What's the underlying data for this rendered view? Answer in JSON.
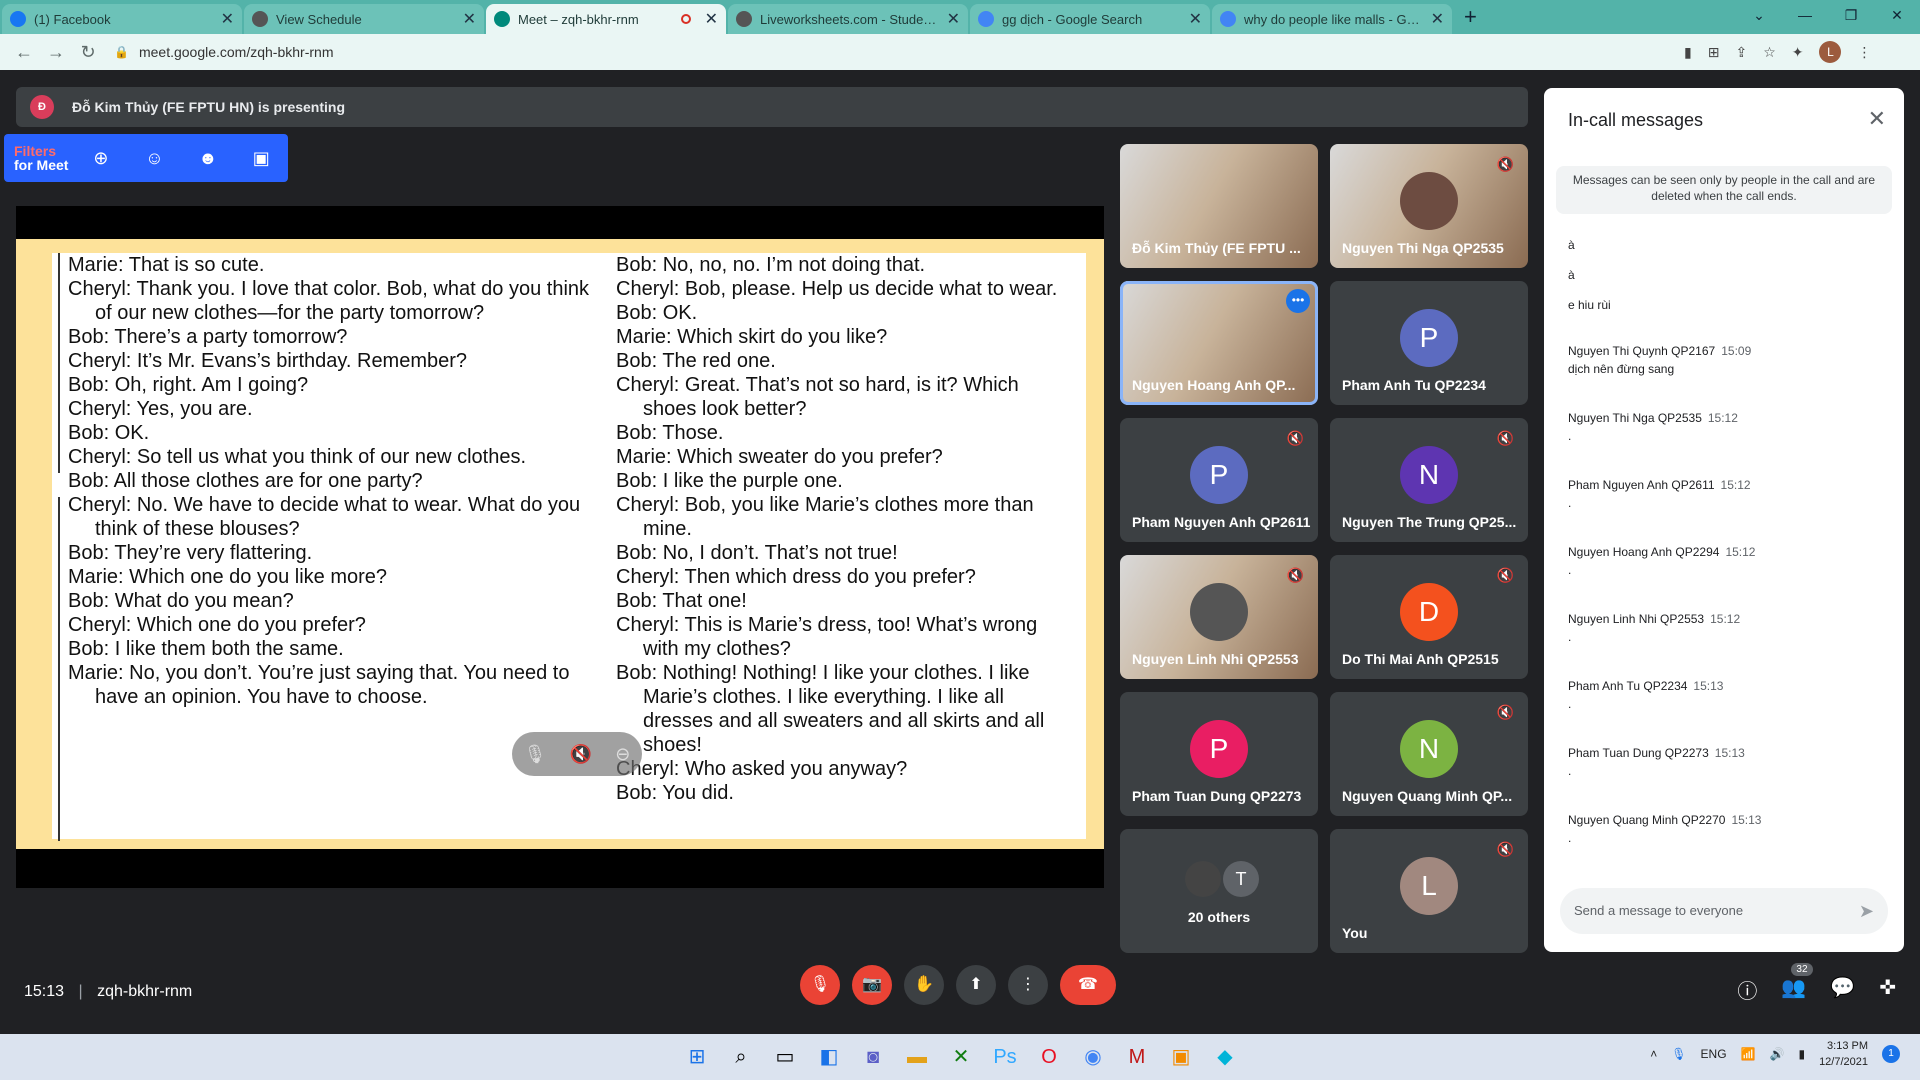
{
  "browser": {
    "tabs": [
      {
        "title": "(1) Facebook",
        "icon": "facebook-icon",
        "color": "#1877f2"
      },
      {
        "title": "View Schedule",
        "icon": "globe-icon",
        "color": "#555"
      },
      {
        "title": "Meet – zqh-bkhr-rnm",
        "icon": "meet-icon",
        "color": "#00897b",
        "active": true
      },
      {
        "title": "Liveworksheets.com - Student w...",
        "icon": "globe-icon",
        "color": "#555"
      },
      {
        "title": "gg dịch - Google Search",
        "icon": "google-icon",
        "color": "#4285f4"
      },
      {
        "title": "why do people like malls - Googl...",
        "icon": "google-icon",
        "color": "#4285f4"
      }
    ],
    "url": "meet.google.com/zqh-bkhr-rnm",
    "profile_initial": "L"
  },
  "presenting": {
    "initial": "Đ",
    "text": "Đỗ Kim Thủy (FE FPTU HN) is presenting"
  },
  "filters": {
    "line1": "Filters",
    "line2": "for Meet"
  },
  "slide": {
    "left": [
      "Marie: That is so cute.",
      "Cheryl: Thank you. I love that color. Bob, what do you think of our new clothes—for the party tomorrow?",
      "Bob: There’s a party tomorrow?",
      "Cheryl: It’s Mr. Evans’s birthday. Remember?",
      "Bob: Oh, right. Am I going?",
      "Cheryl: Yes, you are.",
      "Bob: OK.",
      "Cheryl: So tell us what you think of our new clothes.",
      "Bob: All those clothes are for one party?",
      "Cheryl: No. We have to decide what to wear. What do you think of these blouses?",
      "Bob: They’re very flattering.",
      "Marie: Which one do you like more?",
      "Bob: What do you mean?",
      "Cheryl: Which one do you prefer?",
      "Bob: I like them both the same.",
      "Marie: No, you don’t. You’re just saying that. You need to have an opinion. You have to choose."
    ],
    "right": [
      "Bob: No, no, no. I’m not doing that.",
      "Cheryl: Bob, please. Help us decide what to wear.",
      "Bob: OK.",
      "Marie: Which skirt do you like?",
      "Bob: The red one.",
      "Cheryl: Great. That’s not so hard, is it? Which shoes look better?",
      "Bob: Those.",
      "Marie: Which sweater do you prefer?",
      "Bob: I like the purple one.",
      "Cheryl: Bob, you like Marie’s clothes more than mine.",
      "Bob: No, I don’t. That’s not true!",
      "Cheryl: Then which dress do you prefer?",
      "Bob: That one!",
      "Cheryl: This is Marie’s dress, too! What’s wrong with my clothes?",
      "Bob: Nothing! Nothing! I like your clothes. I like Marie’s clothes. I like everything. I like all dresses and all sweaters and all skirts and all shoes!",
      "Cheryl: Who asked you anyway?",
      "Bob: You did."
    ]
  },
  "participants": [
    {
      "name": "Đỗ Kim Thủy (FE FPTU ...",
      "initial": "",
      "color": "",
      "photo": true,
      "muted": false
    },
    {
      "name": "Nguyen Thi Nga QP2535",
      "initial": "",
      "color": "#6d4c41",
      "photo": true,
      "muted": true
    },
    {
      "name": "Nguyen Hoang Anh QP...",
      "initial": "",
      "color": "",
      "photo": true,
      "muted": false,
      "active": true
    },
    {
      "name": "Pham Anh Tu QP2234",
      "initial": "P",
      "color": "#5c6bc0",
      "muted": false
    },
    {
      "name": "Pham Nguyen Anh QP2611",
      "initial": "P",
      "color": "#5c6bc0",
      "muted": true
    },
    {
      "name": "Nguyen The Trung QP25...",
      "initial": "N",
      "color": "#5e35b1",
      "muted": true
    },
    {
      "name": "Nguyen Linh Nhi QP2553",
      "initial": "",
      "color": "#555",
      "photo": true,
      "muted": true
    },
    {
      "name": "Do Thi Mai Anh QP2515",
      "initial": "D",
      "color": "#f4511e",
      "muted": true
    },
    {
      "name": "Pham Tuan Dung QP2273",
      "initial": "P",
      "color": "#e91e63",
      "muted": false
    },
    {
      "name": "Nguyen Quang Minh QP...",
      "initial": "N",
      "color": "#7cb342",
      "muted": true
    },
    {
      "name": "20 others",
      "initial": "T",
      "color": "#5f6368",
      "muted": false,
      "others": true
    },
    {
      "name": "You",
      "initial": "L",
      "color": "#a1887f",
      "muted": true
    }
  ],
  "chat": {
    "title": "In-call messages",
    "notice": "Messages can be seen only by people in the call and are deleted when the call ends.",
    "first_lines": [
      "à",
      "à",
      "e hiu rùi"
    ],
    "messages": [
      {
        "sender": "Nguyen Thi Quynh QP2167",
        "time": "15:09",
        "body": "dịch nên đừng sang"
      },
      {
        "sender": "Nguyen Thi Nga QP2535",
        "time": "15:12",
        "body": "."
      },
      {
        "sender": "Pham Nguyen Anh QP2611",
        "time": "15:12",
        "body": "."
      },
      {
        "sender": "Nguyen Hoang Anh QP2294",
        "time": "15:12",
        "body": "."
      },
      {
        "sender": "Nguyen Linh Nhi QP2553",
        "time": "15:12",
        "body": "."
      },
      {
        "sender": "Pham Anh Tu QP2234",
        "time": "15:13",
        "body": "."
      },
      {
        "sender": "Pham Tuan Dung QP2273",
        "time": "15:13",
        "body": "."
      },
      {
        "sender": "Nguyen Quang Minh QP2270",
        "time": "15:13",
        "body": "."
      }
    ],
    "input_placeholder": "Send a message to everyone"
  },
  "bottom": {
    "time": "15:13",
    "meeting_code": "zqh-bkhr-rnm",
    "people_count": "32"
  },
  "taskbar": {
    "lang": "ENG",
    "clock_time": "3:13 PM",
    "clock_date": "12/7/2021",
    "notif": "1"
  }
}
